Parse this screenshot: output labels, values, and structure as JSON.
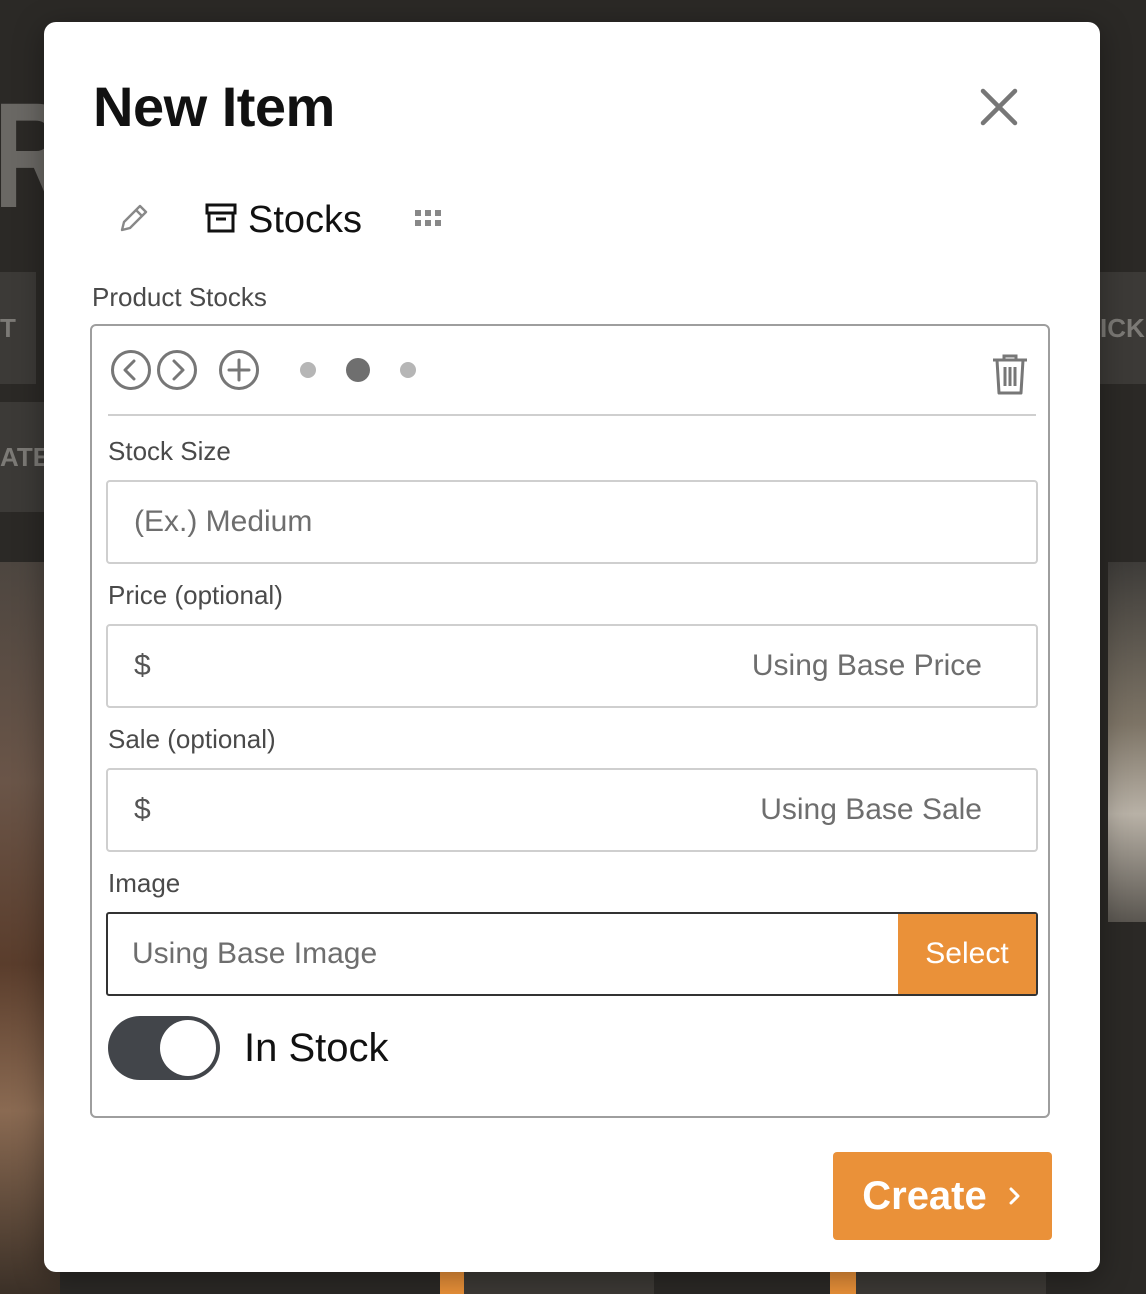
{
  "background": {
    "letter": "R",
    "tiles": [
      "T",
      "ATE",
      "ICK"
    ]
  },
  "modal": {
    "title": "New Item",
    "close_icon": "close-icon",
    "tabs": [
      {
        "icon": "pencil-icon",
        "label": ""
      },
      {
        "icon": "archive-box-icon",
        "label": "Stocks"
      },
      {
        "icon": "grid-icon",
        "label": ""
      }
    ],
    "active_tab": "Stocks",
    "section_label": "Product Stocks",
    "stock_pager": {
      "count": 3,
      "active_index": 1
    },
    "fields": {
      "stock_size": {
        "label": "Stock Size",
        "placeholder": "(Ex.) Medium"
      },
      "price": {
        "label": "Price (optional)",
        "currency": "$",
        "placeholder": "Using Base Price"
      },
      "sale": {
        "label": "Sale (optional)",
        "currency": "$",
        "placeholder": "Using Base Sale"
      },
      "image": {
        "label": "Image",
        "value": "Using Base Image",
        "button": "Select"
      }
    },
    "in_stock": {
      "label": "In Stock",
      "checked": true
    },
    "create_button": "Create"
  },
  "colors": {
    "accent": "#ea9139",
    "toggle_on": "#42454a",
    "backdrop": "#2b2926"
  }
}
